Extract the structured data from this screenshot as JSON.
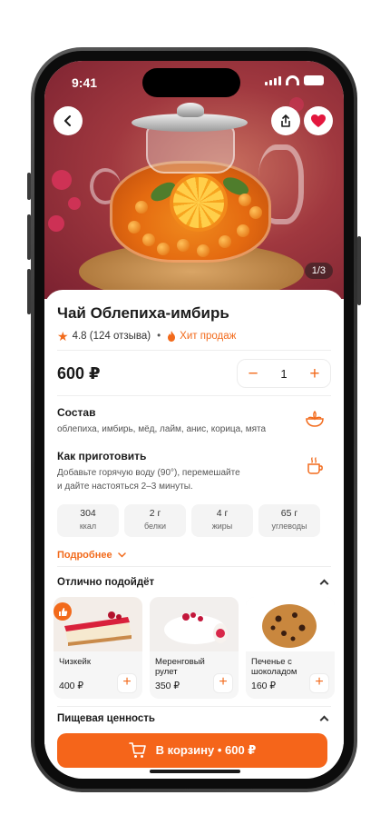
{
  "status_bar": {
    "time": "9:41"
  },
  "hero": {
    "image_icon": "tea-pot-photo",
    "counter": "1/3"
  },
  "header": {
    "back_icon": "chevron-left-icon",
    "share_icon": "share-icon",
    "favorite_icon": "heart-icon"
  },
  "product": {
    "title": "Чай Облепиха-имбирь",
    "rating": "4.8 (124 отзыва)",
    "hit_label": "Хит продаж",
    "price": "600 ₽",
    "quantity": "1"
  },
  "composition": {
    "title": "Состав",
    "text": "облепиха, имбирь, мёд, лайм, анис, корица, мята"
  },
  "how_to": {
    "title": "Как приготовить",
    "text_line1": "Добавьте горячую воду (90°), перемешайте",
    "text_line2": "и дайте настояться 2–3 минуты."
  },
  "more_label": "Подробнее",
  "pairings": {
    "title": "Отлично подойдёт",
    "items": [
      {
        "name": "Чизкейк",
        "price": "400 ₽"
      },
      {
        "name": "Меренговый рулет",
        "price": "350 ₽"
      },
      {
        "name": "Печенье с шоколадом",
        "price": "160 ₽"
      }
    ]
  },
  "nutrition": {
    "title": "Пищевая ценность",
    "items": [
      {
        "value": "304",
        "unit": "ккал"
      },
      {
        "value": "2 г",
        "unit": "белки"
      },
      {
        "value": "4 г",
        "unit": "жиры"
      },
      {
        "value": "65 г",
        "unit": "углеводы"
      }
    ]
  },
  "cart_button": {
    "label": "В корзину • 600 ₽"
  },
  "colors": {
    "accent": "#f5651a",
    "hero_bg": "#a0383f"
  }
}
